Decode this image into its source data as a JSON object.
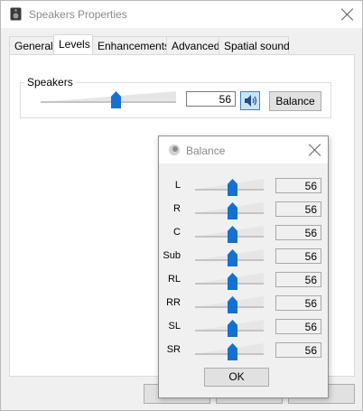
{
  "main": {
    "title": "Speakers Properties",
    "tabs": [
      {
        "label": "General"
      },
      {
        "label": "Levels"
      },
      {
        "label": "Enhancements"
      },
      {
        "label": "Advanced"
      },
      {
        "label": "Spatial sound"
      }
    ],
    "active_tab": "Levels",
    "speakers": {
      "group_label": "Speakers",
      "level_value": "56",
      "level": 56,
      "balance_button": "Balance"
    }
  },
  "balance": {
    "title": "Balance",
    "channels": [
      {
        "label": "L",
        "value": "56",
        "level": 56
      },
      {
        "label": "R",
        "value": "56",
        "level": 56
      },
      {
        "label": "C",
        "value": "56",
        "level": 56
      },
      {
        "label": "Sub",
        "value": "56",
        "level": 56
      },
      {
        "label": "RL",
        "value": "56",
        "level": 56
      },
      {
        "label": "RR",
        "value": "56",
        "level": 56
      },
      {
        "label": "SL",
        "value": "56",
        "level": 56
      },
      {
        "label": "SR",
        "value": "56",
        "level": 56
      }
    ],
    "ok_label": "OK"
  },
  "colors": {
    "accent": "#1570d0",
    "window_bg": "#f0f0f0"
  }
}
